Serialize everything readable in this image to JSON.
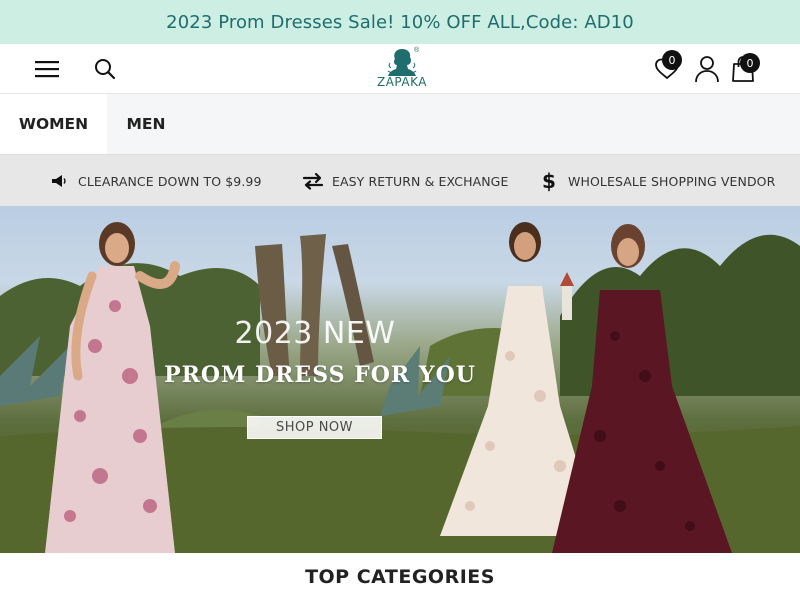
{
  "announcement": {
    "text": "2023 Prom Dresses Sale! 10% OFF ALL,Code: AD10"
  },
  "header": {
    "logo_text": "ZAPAKA",
    "logo_mark": "®",
    "icons": {
      "menu": "hamburger-menu-icon",
      "search": "search-icon",
      "wishlist": "heart-icon",
      "account": "user-icon",
      "cart": "shopping-bag-icon"
    },
    "wishlist_count": "0",
    "cart_count": "0"
  },
  "nav": {
    "items": [
      {
        "label": "WOMEN"
      },
      {
        "label": "MEN"
      }
    ]
  },
  "perks": [
    {
      "icon": "megaphone-icon",
      "label": "CLEARANCE DOWN TO $9.99"
    },
    {
      "icon": "exchange-arrows-icon",
      "label": "EASY RETURN & EXCHANGE"
    },
    {
      "icon": "dollar-icon",
      "label": "WHOLESALE SHOPPING VENDOR"
    }
  ],
  "hero": {
    "kicker": "2023 NEW",
    "title": "PROM DRESS FOR YOU",
    "cta": "SHOP NOW"
  },
  "sections": {
    "top_categories": "TOP CATEGORIES"
  },
  "colors": {
    "announce_bg": "#cdeee3",
    "announce_text": "#1f6d6d",
    "brand": "#1f6d6d",
    "nav_bg": "#f5f6f7",
    "perks_bg": "#e7e7e7"
  }
}
